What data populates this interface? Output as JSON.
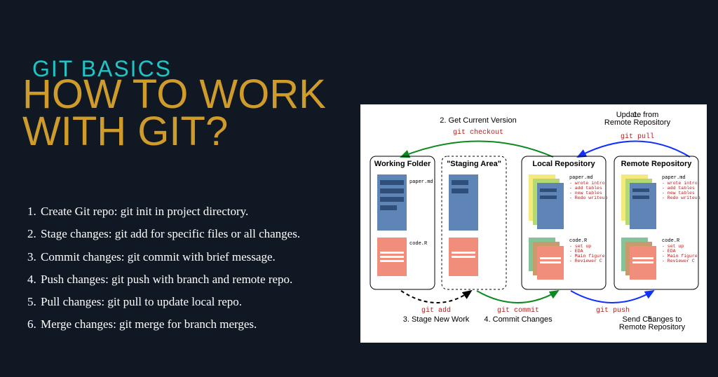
{
  "eyebrow": "GIT BASICS",
  "title": "HOW TO WORK\nWITH GIT?",
  "steps": [
    "Create Git repo: git init in project directory.",
    "Stage changes: git add for specific files or all changes.",
    "Commit changes: git commit with brief message.",
    "Push changes: git push with branch and remote repo.",
    "Pull changes: git pull to update local repo.",
    "Merge changes: git merge for branch merges."
  ],
  "diagram": {
    "columns": {
      "working": "Working Folder",
      "staging": "\"Staging Area\"",
      "local": "Local Repository",
      "remote": "Remote Repository"
    },
    "files": {
      "paper": "paper.md",
      "code": "code.R"
    },
    "paper_notes": [
      "- wrote intro",
      "- add tables",
      "- new tables",
      "- Redo writeup"
    ],
    "code_notes": [
      "- set up",
      "- EDA",
      "- Main figure",
      "- Reviewer C"
    ],
    "flows": {
      "pull": {
        "num": "1.",
        "label": "Update from\nRemote Repository",
        "cmd": "git pull"
      },
      "checkout": {
        "num": "2.",
        "label": "Get Current Version",
        "cmd": "git checkout"
      },
      "add": {
        "num": "3.",
        "label": "Stage New Work",
        "cmd": "git add"
      },
      "commit": {
        "num": "4.",
        "label": "Commit Changes",
        "cmd": "git commit"
      },
      "push": {
        "num": "5.",
        "label": "Send Changes to\nRemote Repository",
        "cmd": "git push"
      }
    }
  }
}
